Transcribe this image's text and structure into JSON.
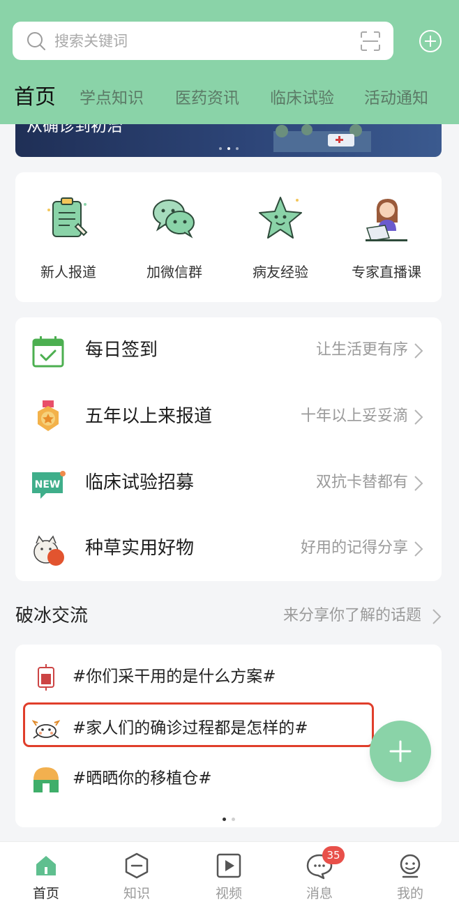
{
  "search": {
    "placeholder": "搜索关键词"
  },
  "tabs": [
    {
      "label": "首页",
      "active": true
    },
    {
      "label": "学点知识"
    },
    {
      "label": "医药资讯"
    },
    {
      "label": "临床试验"
    },
    {
      "label": "活动通知"
    }
  ],
  "banner": {
    "text": "从确诊到初治"
  },
  "quick_actions": [
    {
      "label": "新人报道",
      "icon": "clipboard-icon"
    },
    {
      "label": "加微信群",
      "icon": "wechat-icon"
    },
    {
      "label": "病友经验",
      "icon": "star-icon"
    },
    {
      "label": "专家直播课",
      "icon": "lecturer-icon"
    }
  ],
  "list": [
    {
      "title": "每日签到",
      "subtitle": "让生活更有序",
      "icon": "calendar-check-icon"
    },
    {
      "title": "五年以上来报道",
      "subtitle": "十年以上妥妥滴",
      "icon": "medal-icon"
    },
    {
      "title": "临床试验招募",
      "subtitle": "双抗卡替都有",
      "icon": "new-badge-icon"
    },
    {
      "title": "种草实用好物",
      "subtitle": "好用的记得分享",
      "icon": "lucky-cat-icon"
    }
  ],
  "icebreak": {
    "title": "破冰交流",
    "more": "来分享你了解的话题",
    "topics": [
      {
        "text": "#你们采干用的是什么方案#",
        "icon": "blood-bag-icon"
      },
      {
        "text": "#家人们的确诊过程都是怎样的#",
        "icon": "crab-icon"
      },
      {
        "text": "#晒晒你的移植仓#",
        "icon": "house-icon"
      }
    ]
  },
  "bottom_nav": [
    {
      "label": "首页",
      "icon": "home-icon",
      "active": true
    },
    {
      "label": "知识",
      "icon": "knowledge-icon"
    },
    {
      "label": "视频",
      "icon": "video-icon"
    },
    {
      "label": "消息",
      "icon": "message-icon",
      "badge": "35"
    },
    {
      "label": "我的",
      "icon": "profile-icon"
    }
  ],
  "colors": {
    "brand": "#8ad3a8",
    "highlight": "#e03e2b",
    "badge": "#e8504a"
  }
}
